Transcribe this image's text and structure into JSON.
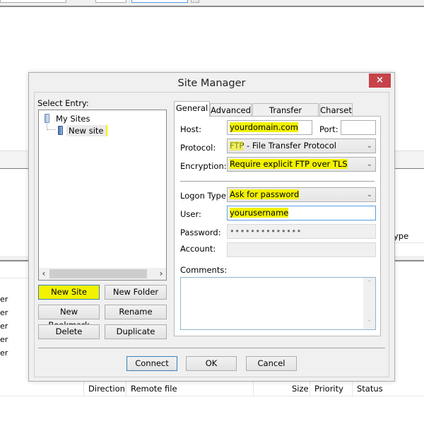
{
  "background": {
    "left_rows": [
      "er",
      "er",
      "er",
      "er",
      "er"
    ],
    "right_header": "ype",
    "queue_columns": [
      "Direction",
      "Remote file",
      "Size",
      "Priority",
      "Status"
    ]
  },
  "dialog": {
    "title": "Site Manager",
    "close_icon": "×",
    "select_entry_label": "Select Entry:",
    "tree": {
      "root": "My Sites",
      "children": [
        "New site"
      ]
    },
    "scroll_left": "‹",
    "scroll_right": "›",
    "buttons": {
      "new_site": "New Site",
      "new_folder": "New Folder",
      "new_bookmark": "New Bookmark",
      "rename": "Rename",
      "delete": "Delete",
      "duplicate": "Duplicate",
      "connect": "Connect",
      "ok": "OK",
      "cancel": "Cancel"
    },
    "tabs": [
      "General",
      "Advanced",
      "Transfer Settings",
      "Charset"
    ],
    "active_tab": "General",
    "general": {
      "host_label": "Host:",
      "host_value": "yourdomain.com",
      "port_label": "Port:",
      "port_value": "",
      "protocol_label": "Protocol:",
      "protocol_value": "FTP - File Transfer Protocol",
      "encryption_label": "Encryption:",
      "encryption_value": "Require explicit FTP over TLS",
      "logon_type_label": "Logon Type:",
      "logon_type_value": "Ask for password",
      "user_label": "User:",
      "user_value": "yourusername",
      "password_label": "Password:",
      "password_value": "••••••••••••••",
      "account_label": "Account:",
      "account_value": "",
      "comments_label": "Comments:",
      "comments_value": ""
    },
    "chevron": "⌄",
    "scroll_up": "˄",
    "scroll_down": "˅"
  },
  "colors": {
    "highlight": "#f2f200",
    "close_button": "#c7434a",
    "focus_border": "#569de5"
  }
}
